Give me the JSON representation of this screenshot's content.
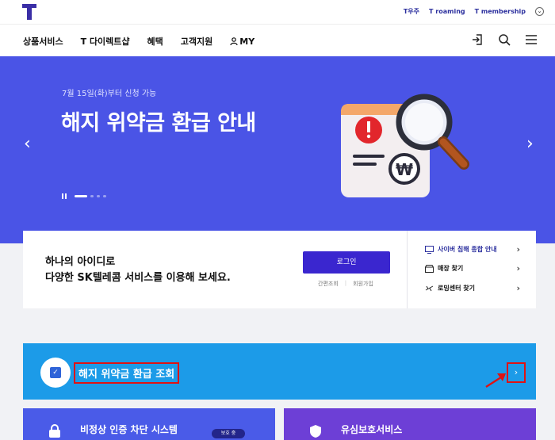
{
  "topbar": {
    "links": [
      "T우주",
      "T roaming",
      "T membership"
    ]
  },
  "gnb": {
    "menu": [
      "상품서비스",
      "T 다이렉트샵",
      "혜택",
      "고객지원",
      "MY"
    ],
    "icons": [
      "login-icon",
      "search-icon",
      "menu-icon"
    ]
  },
  "hero": {
    "sub": "7월 15일(화)부터 신청 가능",
    "title": "해지 위약금 환급 안내",
    "prev": "‹",
    "next": "›",
    "coin": "₩",
    "colors": {
      "background": "#4a54e6"
    }
  },
  "login": {
    "line1": "하나의 아이디로",
    "line2": "다양한 SK텔레콤 서비스를 이용해 보세요.",
    "button": "로그인",
    "easy_login": "간편조회",
    "signup": "회원가입",
    "quick": [
      "사이버 침해 종합 안내",
      "매장 찾기",
      "로밍센터 찾기"
    ]
  },
  "refund": {
    "label": "해지 위약금 환급 조회",
    "go": "›",
    "colors": {
      "background": "#1c9be8",
      "highlight": "#e01212"
    }
  },
  "cards": [
    {
      "title": "비정상 인증 차단 시스템",
      "badge": "보호 중"
    },
    {
      "title": "유심보호서비스"
    }
  ]
}
